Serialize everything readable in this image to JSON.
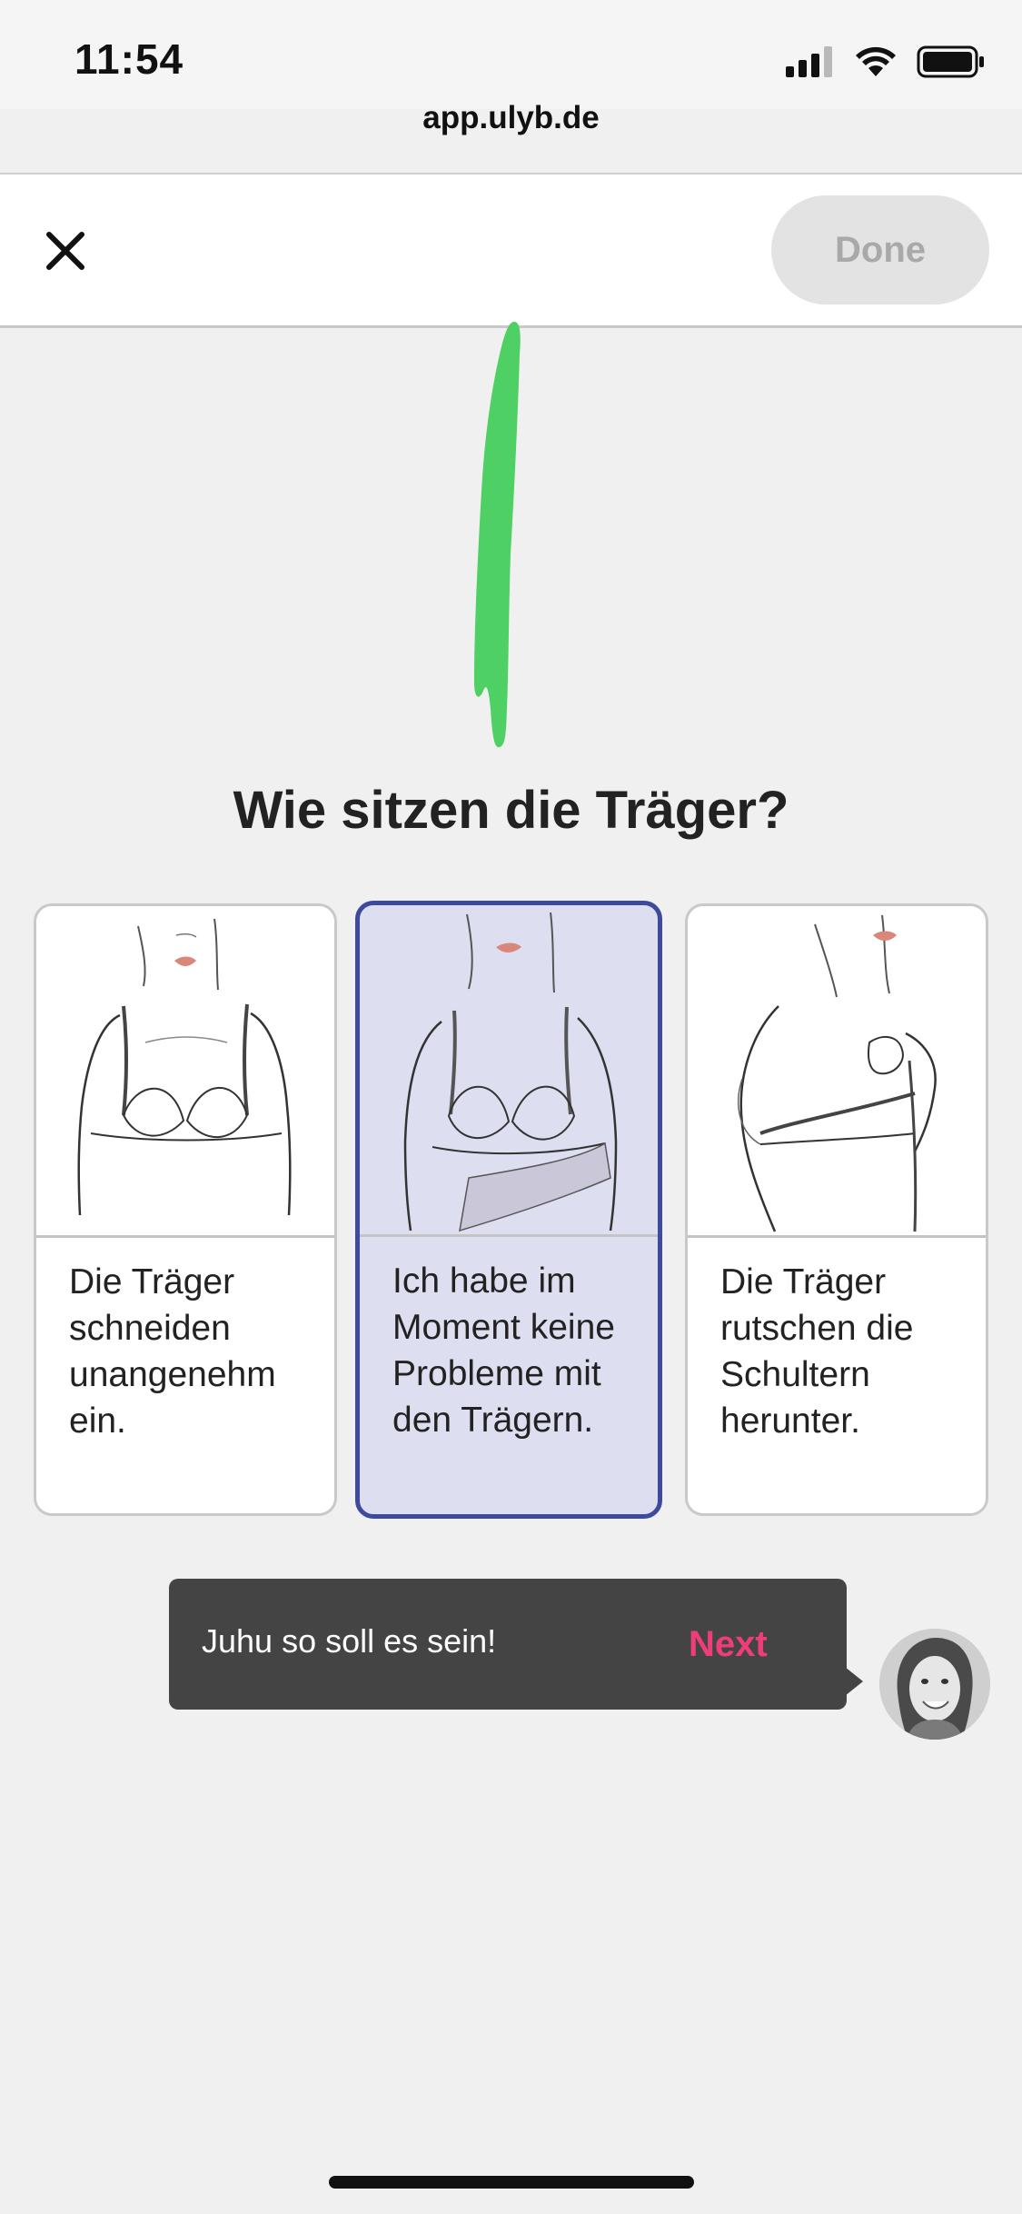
{
  "status_bar": {
    "time": "11:54",
    "icons": [
      "signal-icon",
      "wifi-icon",
      "battery-icon"
    ]
  },
  "browser": {
    "url": "app.ulyb.de"
  },
  "toolbar": {
    "close_icon": "close-icon",
    "done_label": "Done"
  },
  "question": "Wie sitzen die Träger?",
  "options": [
    {
      "text": "Die Träger schneiden unangenehm ein.",
      "selected": false,
      "illustration": "strap-cutting-illustration"
    },
    {
      "text": "Ich habe im Moment keine Probleme mit den Trägern.",
      "selected": true,
      "illustration": "strap-fine-illustration"
    },
    {
      "text": "Die Träger rutschen die Schultern herunter.",
      "selected": false,
      "illustration": "strap-slipping-illustration"
    }
  ],
  "toast": {
    "message": "Juhu so soll es sein!",
    "next_label": "Next"
  },
  "colors": {
    "accent": "#ee3d7a",
    "selected_border": "#3e4a9e",
    "selected_bg": "#dddff0",
    "progress": "#4fd064"
  }
}
